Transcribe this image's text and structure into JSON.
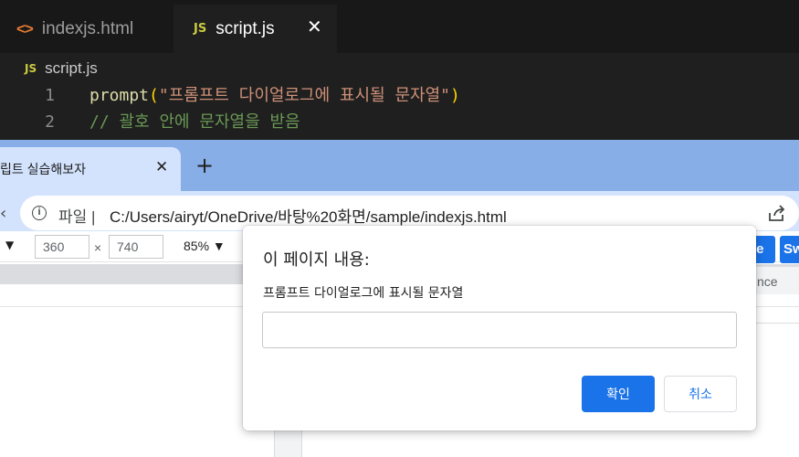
{
  "editor": {
    "tabs": [
      {
        "icon": "<>",
        "label": "indexjs.html",
        "active": false
      },
      {
        "icon": "JS",
        "label": "script.js",
        "active": true
      }
    ],
    "close_glyph": "✕",
    "breadcrumb": {
      "icon": "JS",
      "file": "script.js"
    },
    "lines": [
      {
        "number": "1",
        "fn": "prompt",
        "open": "(",
        "string": "\"프롬프트 다이얼로그에 표시될 문자열\"",
        "close": ")"
      },
      {
        "number": "2",
        "comment": "// 괄호 안에 문자열을 받음"
      }
    ],
    "colors": {
      "background": "#1f1f1f",
      "function": "#dcdcaa",
      "string": "#ce9178",
      "comment": "#6a9955",
      "paren": "#ffd700"
    }
  },
  "browser": {
    "tab": {
      "title": "립트 실습해보자",
      "close": "✕"
    },
    "new_tab": "+",
    "back": "‹",
    "address": {
      "info": "i",
      "scheme": "파일 |",
      "url": "C:/Users/airyt/OneDrive/바탕%20화면/sample/indexjs.html"
    },
    "devtools": {
      "device_dropdown": "▼",
      "width": "360",
      "separator": "×",
      "height": "740",
      "zoom": "85% ▼",
      "btn1": "ge",
      "btn2": "Sw",
      "panel_text": "nce"
    },
    "colors": {
      "tabstrip": "#88aee8",
      "active_tab": "#d3e3fd",
      "accent": "#1a73e8"
    }
  },
  "dialog": {
    "title": "이 페이지 내용:",
    "message": "프롬프트 다이얼로그에 표시될 문자열",
    "input_value": "",
    "ok_label": "확인",
    "cancel_label": "취소"
  }
}
